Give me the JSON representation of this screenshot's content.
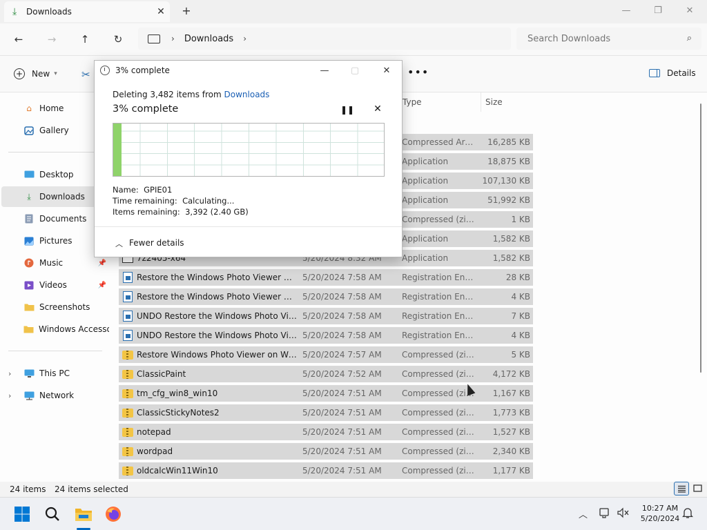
{
  "window": {
    "tab_title": "Downloads",
    "new_tab": "+",
    "minimize": "—",
    "maximize": "❐",
    "close": "✕"
  },
  "nav": {
    "back": "←",
    "forward": "→",
    "up": "↑",
    "refresh": "↻",
    "breadcrumb": [
      "Downloads"
    ],
    "search_placeholder": "Search Downloads"
  },
  "toolbar": {
    "new_label": "New",
    "more": "•••",
    "details_label": "Details"
  },
  "sidebar": {
    "items": [
      {
        "label": "Home",
        "icon": "home-icon"
      },
      {
        "label": "Gallery",
        "icon": "gallery-icon"
      },
      {
        "label": "Desktop",
        "icon": "desktop-icon"
      },
      {
        "label": "Downloads",
        "icon": "download-icon"
      },
      {
        "label": "Documents",
        "icon": "document-icon"
      },
      {
        "label": "Pictures",
        "icon": "pictures-icon"
      },
      {
        "label": "Music",
        "icon": "music-icon"
      },
      {
        "label": "Videos",
        "icon": "videos-icon"
      },
      {
        "label": "Screenshots",
        "icon": "folder-icon"
      },
      {
        "label": "Windows Accessories",
        "icon": "folder-icon"
      },
      {
        "label": "This PC",
        "icon": "pc-icon"
      },
      {
        "label": "Network",
        "icon": "network-icon"
      }
    ]
  },
  "columns": {
    "type": "Type",
    "size": "Size"
  },
  "files": [
    {
      "name": "",
      "date": "",
      "type": "Compressed Archi...",
      "size": "16,285 KB",
      "icon": "zip"
    },
    {
      "name": "",
      "date": "",
      "type": "Application",
      "size": "18,875 KB",
      "icon": "app"
    },
    {
      "name": "",
      "date": "",
      "type": "Application",
      "size": "107,130 KB",
      "icon": "app"
    },
    {
      "name": "",
      "date": "",
      "type": "Application",
      "size": "51,992 KB",
      "icon": "app"
    },
    {
      "name": "",
      "date": "",
      "type": "Compressed (zipp...",
      "size": "1 KB",
      "icon": "zip"
    },
    {
      "name": "",
      "date": "",
      "type": "Application",
      "size": "1,582 KB",
      "icon": "app"
    },
    {
      "name": "7z2405-x64",
      "date": "5/20/2024 8:32 AM",
      "type": "Application",
      "size": "1,582 KB",
      "icon": "app"
    },
    {
      "name": "Restore the Windows Photo Viewer ALL ...",
      "date": "5/20/2024 7:58 AM",
      "type": "Registration Entries",
      "size": "28 KB",
      "icon": "reg"
    },
    {
      "name": "Restore the Windows Photo Viewer CURR...",
      "date": "5/20/2024 7:58 AM",
      "type": "Registration Entries",
      "size": "4 KB",
      "icon": "reg"
    },
    {
      "name": "UNDO Restore the Windows Photo Viewe...",
      "date": "5/20/2024 7:58 AM",
      "type": "Registration Entries",
      "size": "7 KB",
      "icon": "reg"
    },
    {
      "name": "UNDO Restore the Windows Photo Viewe...",
      "date": "5/20/2024 7:58 AM",
      "type": "Registration Entries",
      "size": "4 KB",
      "icon": "reg"
    },
    {
      "name": "Restore Windows Photo Viewer on Wind...",
      "date": "5/20/2024 7:57 AM",
      "type": "Compressed (zipp...",
      "size": "5 KB",
      "icon": "zip"
    },
    {
      "name": "ClassicPaint",
      "date": "5/20/2024 7:52 AM",
      "type": "Compressed (zipp...",
      "size": "4,172 KB",
      "icon": "zip"
    },
    {
      "name": "tm_cfg_win8_win10",
      "date": "5/20/2024 7:51 AM",
      "type": "Compressed (zipp...",
      "size": "1,167 KB",
      "icon": "zip"
    },
    {
      "name": "ClassicStickyNotes2",
      "date": "5/20/2024 7:51 AM",
      "type": "Compressed (zipp...",
      "size": "1,773 KB",
      "icon": "zip"
    },
    {
      "name": "notepad",
      "date": "5/20/2024 7:51 AM",
      "type": "Compressed (zipp...",
      "size": "1,527 KB",
      "icon": "zip"
    },
    {
      "name": "wordpad",
      "date": "5/20/2024 7:51 AM",
      "type": "Compressed (zipp...",
      "size": "2,340 KB",
      "icon": "zip"
    },
    {
      "name": "oldcalcWin11Win10",
      "date": "5/20/2024 7:51 AM",
      "type": "Compressed (zipp...",
      "size": "1,177 KB",
      "icon": "zip"
    }
  ],
  "status": {
    "count": "24 items",
    "selected": "24 items selected"
  },
  "dialog": {
    "title": "3% complete",
    "line_prefix": "Deleting 3,482 items from ",
    "line_link": "Downloads",
    "headline": "3% complete",
    "progress_percent": 3,
    "name_label": "Name:",
    "name_value": "GPIE01",
    "time_label": "Time remaining:",
    "time_value": "Calculating...",
    "items_label": "Items remaining:",
    "items_value": "3,392 (2.40 GB)",
    "fewer_details": "Fewer details"
  },
  "taskbar": {
    "time": "10:27 AM",
    "date": "5/20/2024"
  },
  "colors": {
    "accent": "#0067c0",
    "link": "#1a5fb4",
    "progress": "#8fd36a",
    "selection": "#d8d8d8"
  }
}
